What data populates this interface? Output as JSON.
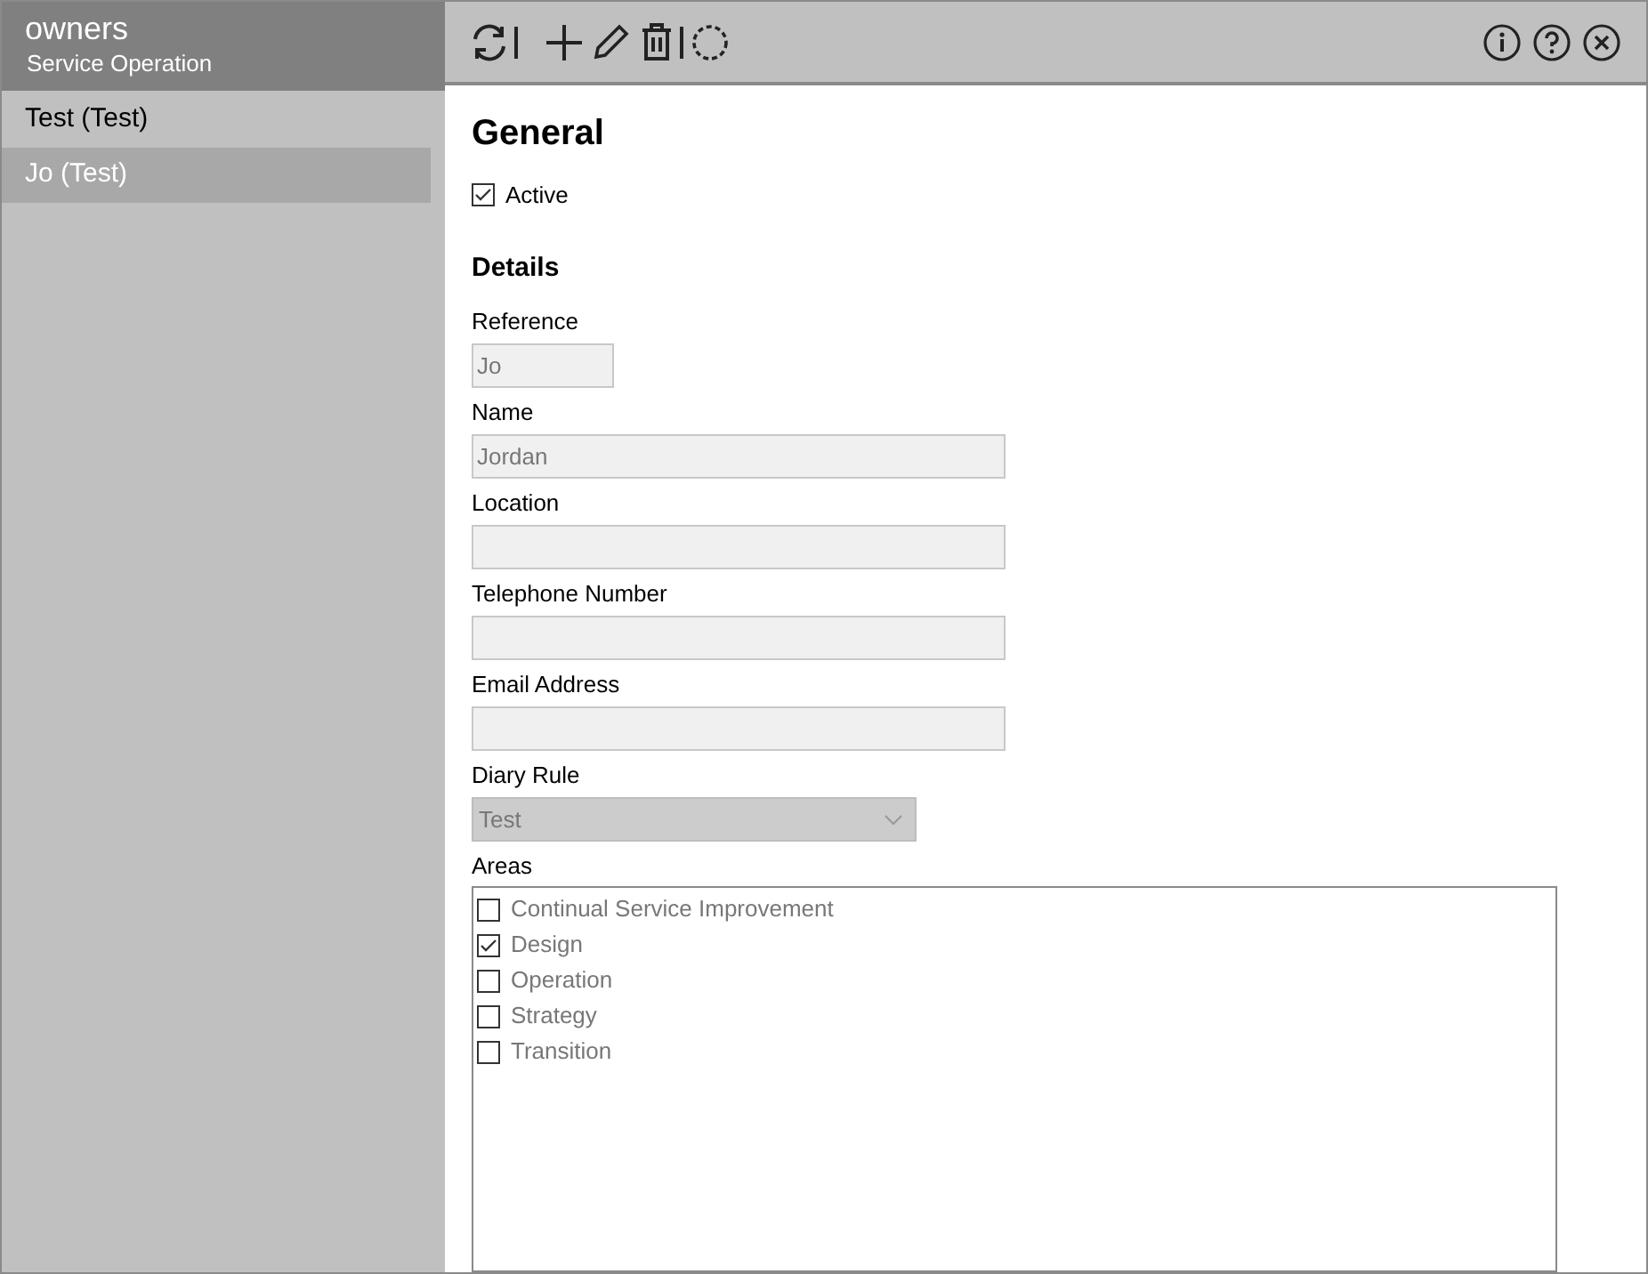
{
  "sidebar": {
    "title": "owners",
    "subtitle": "Service Operation",
    "items": [
      {
        "label": "Test (Test)",
        "selected": false
      },
      {
        "label": "Jo (Test)",
        "selected": true
      }
    ]
  },
  "form": {
    "heading": "General",
    "active": {
      "label": "Active",
      "checked": true
    },
    "section": "Details",
    "fields": [
      {
        "kind": "text",
        "label": "Reference",
        "value": "Jo"
      },
      {
        "kind": "text",
        "label": "Name",
        "value": "Jordan"
      },
      {
        "kind": "text",
        "label": "Location"
      },
      {
        "kind": "text",
        "label": "Telephone Number"
      },
      {
        "kind": "text",
        "label": "Email Address"
      },
      {
        "kind": "select",
        "label": "Diary Rule",
        "value": "Test"
      }
    ],
    "areas": {
      "label": "Areas",
      "items": [
        {
          "label": "Continual Service Improvement",
          "checked": false
        },
        {
          "label": "Design",
          "checked": true
        },
        {
          "label": "Operation",
          "checked": false
        },
        {
          "label": "Strategy",
          "checked": false
        },
        {
          "label": "Transition",
          "checked": false
        }
      ]
    }
  }
}
